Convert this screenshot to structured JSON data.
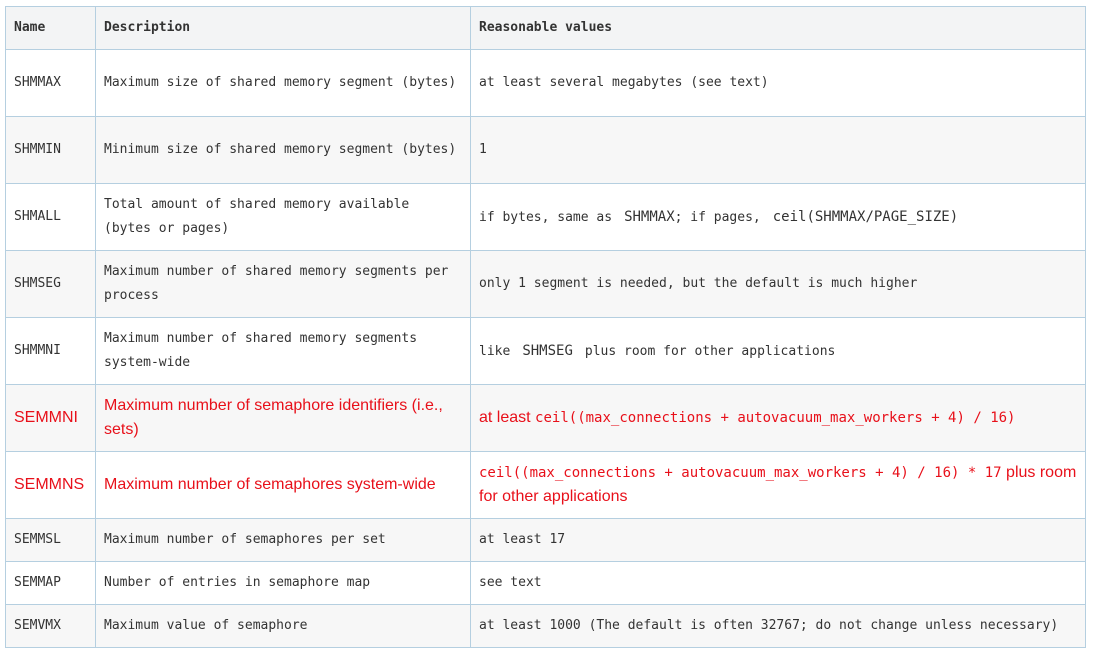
{
  "headers": [
    "Name",
    "Description",
    "Reasonable values"
  ],
  "rows": [
    {
      "name": "SHMMAX",
      "desc": "Maximum size of shared memory segment (bytes)",
      "value": "at least several megabytes (see text)"
    },
    {
      "name": "SHMMIN",
      "desc": "Minimum size of shared memory segment (bytes)",
      "value": "1"
    },
    {
      "name": "SHMALL",
      "desc": "Total amount of shared memory available (bytes or pages)",
      "value_parts": [
        "if bytes, same as",
        "SHMMAX",
        "; if pages,",
        "ceil(SHMMAX/PAGE_SIZE)"
      ]
    },
    {
      "name": "SHMSEG",
      "desc": "Maximum number of shared memory segments per process",
      "value": "only 1 segment is needed, but the default is much higher"
    },
    {
      "name": "SHMMNI",
      "desc": "Maximum number of shared memory segments system-wide",
      "value_parts": [
        "like",
        "SHMSEG",
        "plus room for other applications"
      ]
    },
    {
      "name": "SEMMNI",
      "desc": "Maximum number of semaphore identifiers (i.e., sets)",
      "value_parts": [
        "at least",
        "ceil((max_connections + autovacuum_max_workers + 4) / 16)"
      ],
      "highlight": true
    },
    {
      "name": "SEMMNS",
      "desc": "Maximum number of semaphores system-wide",
      "value_parts": [
        "ceil((max_connections + autovacuum_max_workers + 4) / 16) * 17",
        "plus room for other applications"
      ],
      "highlight": true
    },
    {
      "name": "SEMMSL",
      "desc": "Maximum number of semaphores per set",
      "value": "at least 17"
    },
    {
      "name": "SEMMAP",
      "desc": "Number of entries in semaphore map",
      "value": "see text"
    },
    {
      "name": "SEMVMX",
      "desc": "Maximum value of semaphore",
      "value": "at least 1000 (The default is often 32767; do not change unless necessary)"
    }
  ]
}
